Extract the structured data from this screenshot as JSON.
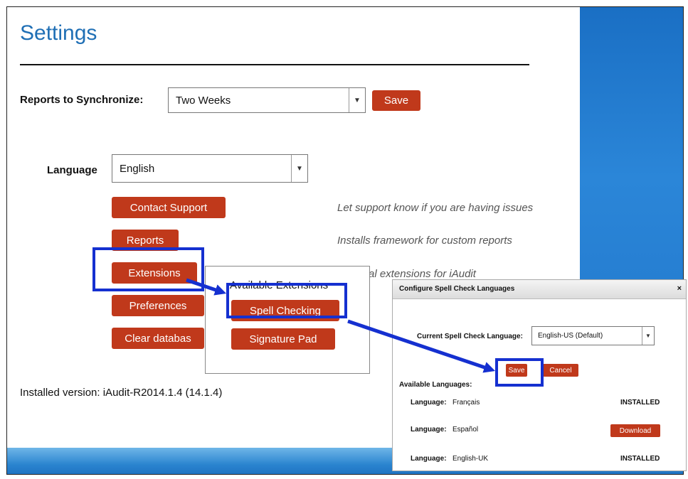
{
  "page": {
    "title": "Settings"
  },
  "sync": {
    "label": "Reports to Synchronize:",
    "value": "Two Weeks",
    "save_label": "Save"
  },
  "language": {
    "label": "Language",
    "value": "English"
  },
  "actions": [
    {
      "label": "Contact Support",
      "desc": "Let support know if you are having issues"
    },
    {
      "label": "Reports",
      "desc": "Installs framework for custom reports"
    },
    {
      "label": "Extensions",
      "desc": "al extensions for iAudit"
    },
    {
      "label": "Preferences"
    },
    {
      "label": "Clear databas"
    }
  ],
  "version": "Installed version: iAudit-R2014.1.4 (14.1.4)",
  "extensions_popup": {
    "title": "Available Extensions",
    "items": [
      "Spell Checking",
      "Signature Pad"
    ]
  },
  "dialog": {
    "title": "Configure Spell Check Languages",
    "close": "×",
    "current_label": "Current Spell Check Language:",
    "current_value": "English-US (Default)",
    "save_label": "Save",
    "cancel_label": "Cancel",
    "available_heading": "Available Languages:",
    "language_prefix": "Language:",
    "languages": [
      {
        "name": "Français",
        "status": "INSTALLED"
      },
      {
        "name": "Español",
        "action": "Download"
      },
      {
        "name": "English-UK",
        "status": "INSTALLED"
      }
    ]
  },
  "colors": {
    "accent": "#c0391b",
    "highlight": "#1530d0",
    "title": "#1f6fb5"
  },
  "icons": {
    "dropdown": "chevron-down-icon",
    "close": "close-icon",
    "arrow": "annotation-arrow"
  }
}
